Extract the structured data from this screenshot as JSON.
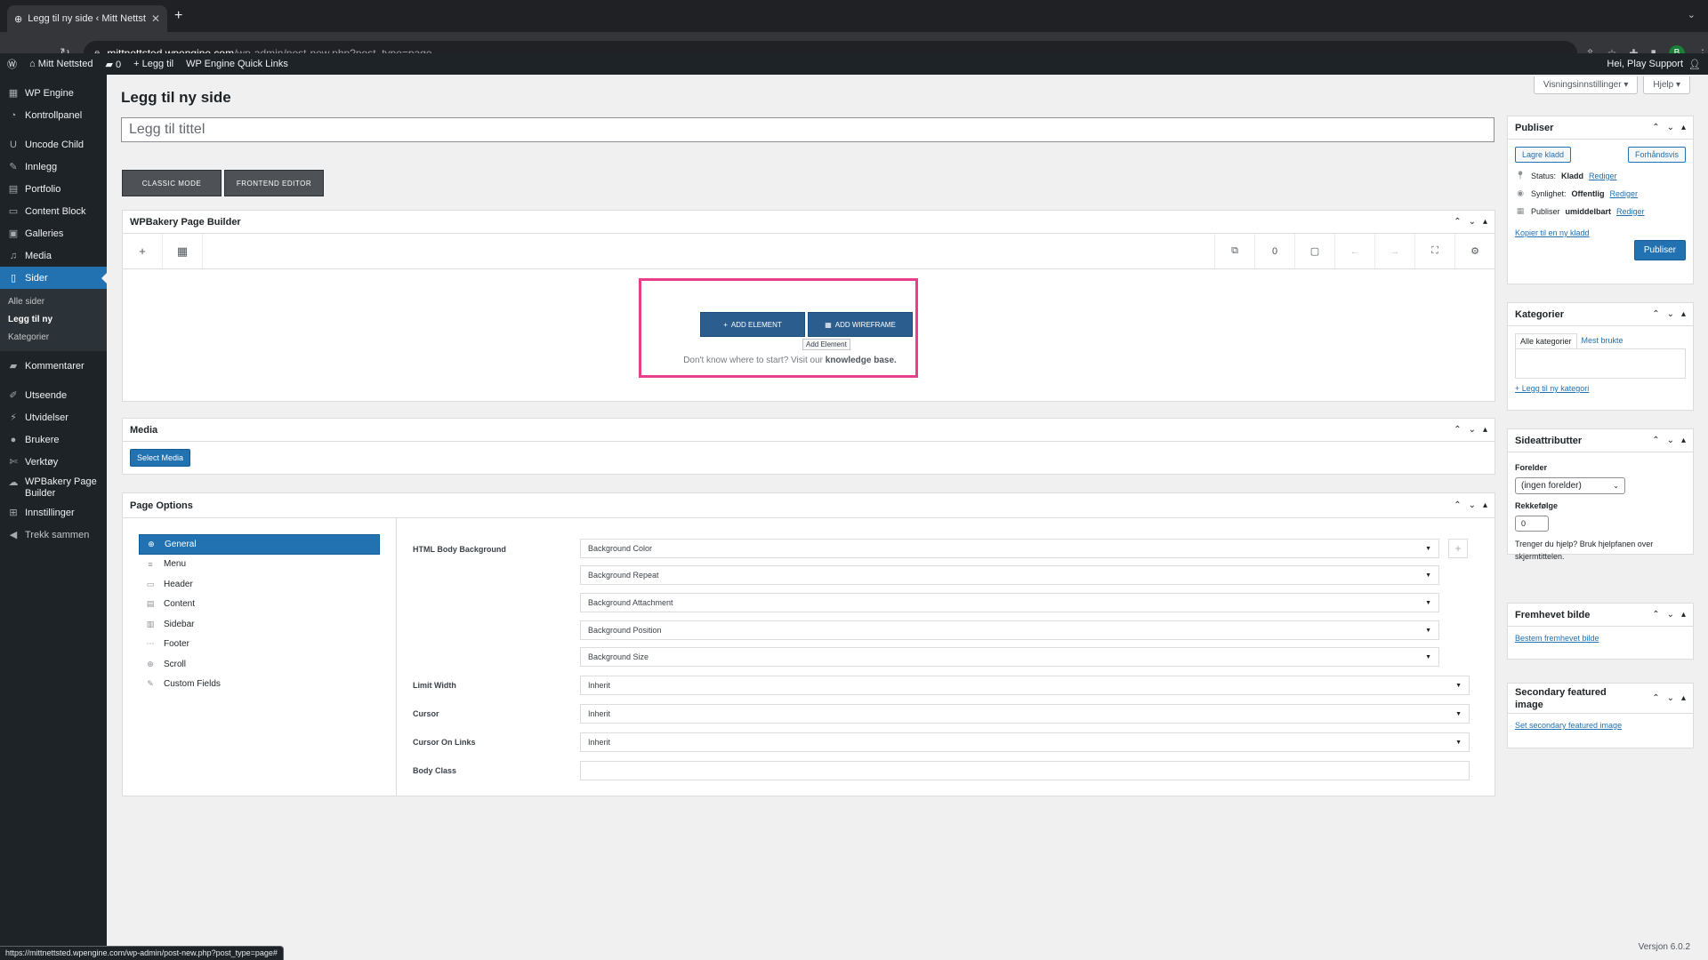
{
  "browser": {
    "tab_title": "Legg til ny side ‹ Mitt Nettsted",
    "url_host": "mittnettsted.wpengine.com",
    "url_path": "/wp-admin/post-new.php?post_type=page",
    "profile_initial": "B",
    "status_url": "https://mittnettsted.wpengine.com/wp-admin/post-new.php?post_type=page#"
  },
  "adminbar": {
    "site_name": "Mitt Nettsted",
    "comments_count": "0",
    "new_label": "Legg til",
    "quick_links": "WP Engine Quick Links",
    "greeting": "Hei, Play Support"
  },
  "sidebar": {
    "items": [
      {
        "label": "WP Engine",
        "icon": "wpengine-icon"
      },
      {
        "label": "Kontrollpanel",
        "icon": "dashboard-icon"
      },
      {
        "label": "Uncode Child",
        "icon": "uncode-icon"
      },
      {
        "label": "Innlegg",
        "icon": "pin-icon"
      },
      {
        "label": "Portfolio",
        "icon": "portfolio-icon"
      },
      {
        "label": "Content Block",
        "icon": "content-block-icon"
      },
      {
        "label": "Galleries",
        "icon": "galleries-icon"
      },
      {
        "label": "Media",
        "icon": "media-icon"
      },
      {
        "label": "Sider",
        "icon": "pages-icon"
      },
      {
        "label": "Kommentarer",
        "icon": "comments-icon"
      },
      {
        "label": "Utseende",
        "icon": "appearance-icon"
      },
      {
        "label": "Utvidelser",
        "icon": "plugins-icon"
      },
      {
        "label": "Brukere",
        "icon": "users-icon"
      },
      {
        "label": "Verktøy",
        "icon": "tools-icon"
      },
      {
        "label": "WPBakery Page Builder",
        "icon": "wpbakery-icon"
      },
      {
        "label": "Innstillinger",
        "icon": "settings-icon"
      },
      {
        "label": "Trekk sammen",
        "icon": "collapse-icon"
      }
    ],
    "submenu": [
      "Alle sider",
      "Legg til ny",
      "Kategorier"
    ]
  },
  "main": {
    "screen_options": "Visningsinnstillinger",
    "help": "Hjelp",
    "page_title": "Legg til ny side",
    "title_placeholder": "Legg til tittel",
    "classic_mode": "CLASSIC MODE",
    "frontend_editor": "FRONTEND EDITOR"
  },
  "wpbakery": {
    "title": "WPBakery Page Builder",
    "counter": "0",
    "add_element": "ADD ELEMENT",
    "add_wireframe": "ADD WIREFRAME",
    "tooltip": "Add Element",
    "help_text": "Don't know where to start? Visit our",
    "help_link": "knowledge base."
  },
  "media_box": {
    "title": "Media",
    "button": "Select Media"
  },
  "page_options": {
    "title": "Page Options",
    "nav": [
      {
        "label": "General",
        "icon": "globe-icon"
      },
      {
        "label": "Menu",
        "icon": "menu-icon"
      },
      {
        "label": "Header",
        "icon": "header-icon"
      },
      {
        "label": "Content",
        "icon": "content-icon"
      },
      {
        "label": "Sidebar",
        "icon": "sidebar-icon"
      },
      {
        "label": "Footer",
        "icon": "footer-icon"
      },
      {
        "label": "Scroll",
        "icon": "scroll-icon"
      },
      {
        "label": "Custom Fields",
        "icon": "pencil-icon"
      }
    ],
    "html_body_bg_label": "HTML Body Background",
    "bg_selects": [
      "Background Color",
      "Background Repeat",
      "Background Attachment",
      "Background Position",
      "Background Size"
    ],
    "limit_width_label": "Limit Width",
    "limit_width_value": "Inherit",
    "cursor_label": "Cursor",
    "cursor_value": "Inherit",
    "cursor_links_label": "Cursor On Links",
    "cursor_links_value": "Inherit",
    "body_class_label": "Body Class"
  },
  "publish": {
    "title": "Publiser",
    "save_draft": "Lagre kladd",
    "preview": "Forhåndsvis",
    "status_label": "Status:",
    "status_value": "Kladd",
    "visibility_label": "Synlighet:",
    "visibility_value": "Offentlig",
    "publish_label": "Publiser",
    "publish_value": "umiddelbart",
    "edit": "Rediger",
    "copy_draft": "Kopier til en ny kladd",
    "publish_button": "Publiser"
  },
  "categories": {
    "title": "Kategorier",
    "tab_all": "Alle kategorier",
    "tab_most": "Mest brukte",
    "add_new": "+ Legg til ny kategori"
  },
  "page_attributes": {
    "title": "Sideattributter",
    "parent_label": "Forelder",
    "parent_value": "(ingen forelder)",
    "order_label": "Rekkefølge",
    "order_value": "0",
    "help": "Trenger du hjelp? Bruk hjelpfanen over skjermtittelen."
  },
  "featured": {
    "title": "Fremhevet bilde",
    "link": "Bestem fremhevet bilde"
  },
  "secondary_featured": {
    "title": "Secondary featured image",
    "link": "Set secondary featured image"
  },
  "footer": {
    "version": "Versjon 6.0.2"
  }
}
